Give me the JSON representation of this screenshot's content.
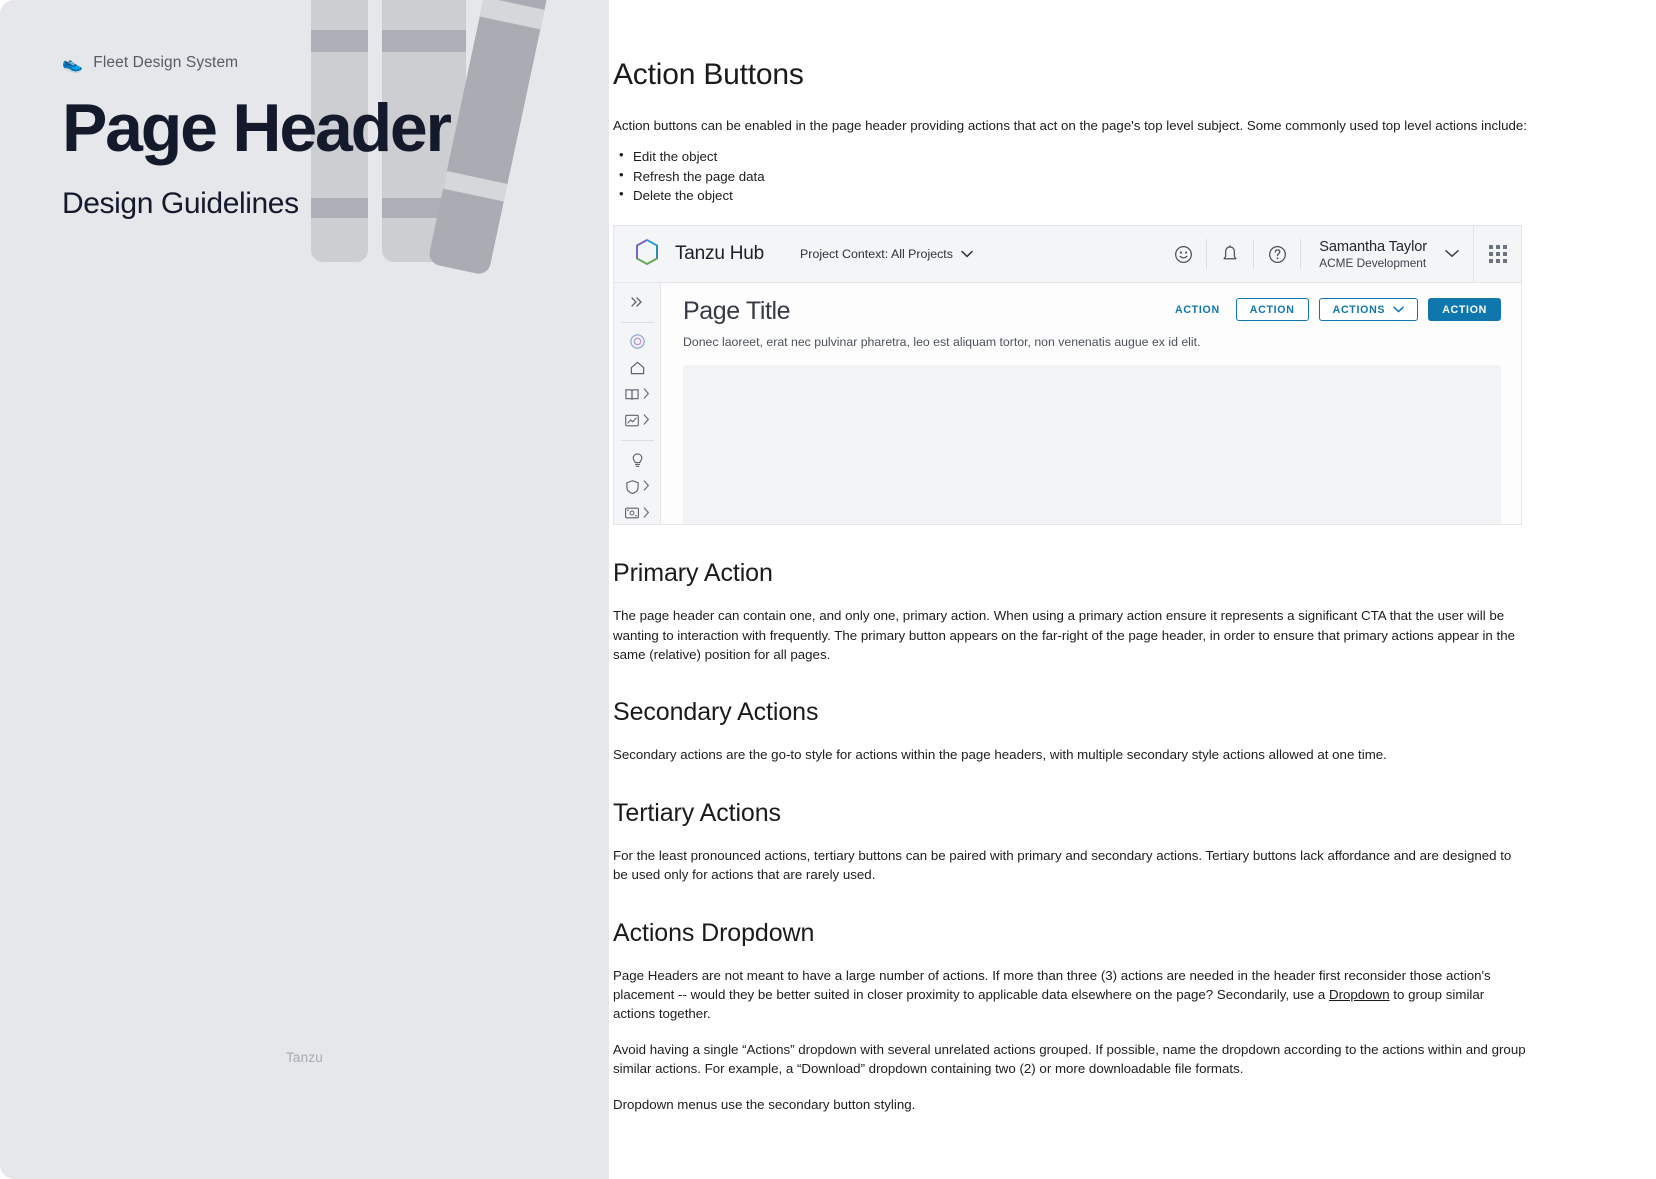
{
  "cover": {
    "eyebrow": "Fleet Design System",
    "eyebrow_icon": "sneaker-icon",
    "title": "Page Header",
    "subtitle": "Design Guidelines",
    "footer": "Tanzu"
  },
  "doc": {
    "h1": "Action Buttons",
    "intro": "Action buttons can be enabled in the page header providing actions that act on the page's top level subject. Some commonly used top level actions include:",
    "bullets": [
      "Edit the object",
      "Refresh the page data",
      "Delete the object"
    ],
    "sections": [
      {
        "heading": "Primary Action",
        "body": "The page header can contain one, and only one, primary action. When using a primary action ensure it represents a significant CTA that the user will be wanting to interaction with frequently. The primary button appears on the far-right of the page header, in order to ensure that primary actions appear in the same (relative) position for all pages."
      },
      {
        "heading": "Secondary Actions",
        "body": "Secondary actions are the go-to style for actions within the page headers, with multiple secondary style actions allowed at one time."
      },
      {
        "heading": "Tertiary Actions",
        "body": "For the least pronounced actions, tertiary buttons can be paired with primary and secondary actions. Tertiary buttons lack affordance and are designed to be used only for actions that are rarely used."
      }
    ],
    "dropdown_section": {
      "heading": "Actions Dropdown",
      "p1_before": "Page Headers are not meant to have a large number of actions. If more than three (3) actions are needed in the header first reconsider those action's placement -- would they be better suited in closer proximity to applicable data elsewhere on the page? Secondarily, use a ",
      "p1_link": "Dropdown",
      "p1_after": " to group similar actions together.",
      "p2": "Avoid having a single “Actions” dropdown with several unrelated actions grouped. If possible, name the dropdown according to the actions within and group similar actions. For example, a “Download” dropdown containing two (2) or more downloadable file formats.",
      "p3": "Dropdown menus use the secondary button styling."
    }
  },
  "appmock": {
    "brand": "Tanzu Hub",
    "brand_logo": "tanzu-hexagon-logo",
    "project_context": "Project Context: All Projects",
    "top_icons": [
      "smiley-icon",
      "bell-icon",
      "help-icon"
    ],
    "user": {
      "name": "Samantha Taylor",
      "org": "ACME Development"
    },
    "apps_grid_icon": "apps-grid-icon",
    "rail": [
      {
        "icon": "double-chevron-right-icon",
        "expandable": false
      },
      {
        "icon": "target-circle-icon",
        "expandable": false
      },
      {
        "icon": "home-icon",
        "expandable": false
      },
      {
        "icon": "book-icon",
        "expandable": true
      },
      {
        "icon": "chart-icon",
        "expandable": true
      },
      {
        "icon": "lightbulb-icon",
        "expandable": false
      },
      {
        "icon": "shield-icon",
        "expandable": true
      },
      {
        "icon": "card-icon",
        "expandable": true
      }
    ],
    "page_title": "Page Title",
    "page_subtitle": "Donec laoreet, erat nec pulvinar pharetra, leo est aliquam tortor, non venenatis augue ex id elit.",
    "buttons": {
      "tertiary": "ACTION",
      "secondary": "ACTION",
      "dropdown": "ACTIONS",
      "primary": "ACTION"
    }
  },
  "colors": {
    "accent_blue": "#0f77ad",
    "cover_bg": "#e5e7ea",
    "title_navy": "#141a2b"
  }
}
